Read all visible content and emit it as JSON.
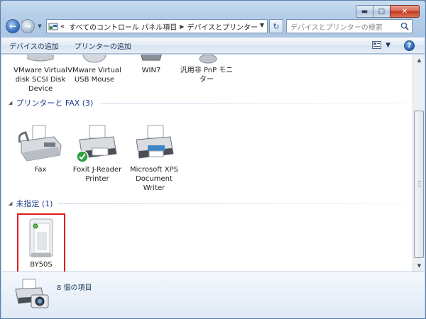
{
  "window": {
    "controls": {
      "minimize": "▬",
      "maximize": "□",
      "close": "✕"
    }
  },
  "navigation": {
    "back": "←",
    "forward": "→",
    "breadcrumb": {
      "overflow": "«",
      "parent": "すべてのコントロール パネル項目",
      "current": "デバイスとプリンター"
    },
    "search_placeholder": "デバイスとプリンターの検索"
  },
  "commandbar": {
    "add_device": "デバイスの追加",
    "add_printer": "プリンターの追加"
  },
  "groups": {
    "devices_partial": [
      {
        "label": "VMware Virtual disk SCSI Disk Device",
        "icon": "disk-drive-icon"
      },
      {
        "label": "VMware Virtual USB Mouse",
        "icon": "mouse-icon"
      },
      {
        "label": "WIN7",
        "icon": "computer-icon"
      },
      {
        "label": "汎用非 PnP モニター",
        "icon": "monitor-icon"
      }
    ],
    "printers": {
      "header": "プリンターと FAX (3)",
      "items": [
        {
          "label": "Fax",
          "icon": "fax-icon"
        },
        {
          "label": "Foxit J-Reader Printer",
          "icon": "printer-default-icon"
        },
        {
          "label": "Microsoft XPS Document Writer",
          "icon": "printer-icon"
        }
      ]
    },
    "unspecified": {
      "header": "未指定 (1)",
      "items": [
        {
          "label": "BY50S",
          "icon": "device-tower-icon"
        }
      ]
    }
  },
  "details": {
    "item_count": "8 個の項目"
  },
  "colors": {
    "accent": "#1e3c8a",
    "highlight": "#e21b1b"
  }
}
